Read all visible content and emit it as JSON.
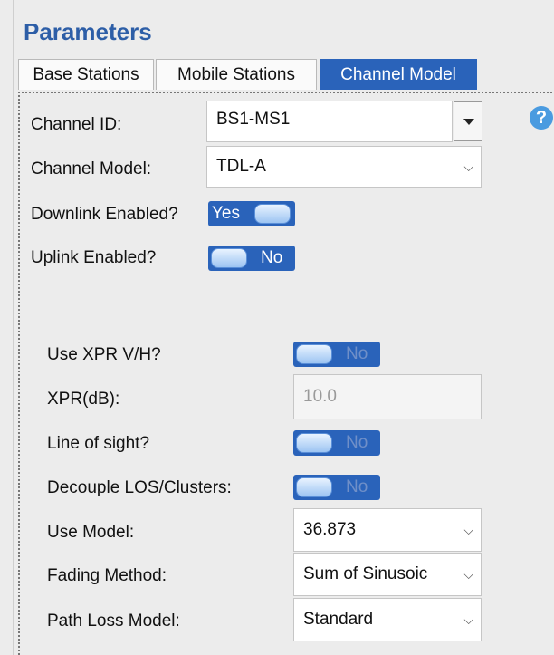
{
  "header": {
    "title": "Parameters"
  },
  "tabs": [
    {
      "label": "Base Stations"
    },
    {
      "label": "Mobile Stations"
    },
    {
      "label": "Channel Model"
    }
  ],
  "general": {
    "channel_id": {
      "label": "Channel ID:",
      "value": "BS1-MS1"
    },
    "channel_model": {
      "label": "Channel Model:",
      "value": "TDL-A"
    },
    "downlink": {
      "label": "Downlink Enabled?",
      "value": "Yes"
    },
    "uplink": {
      "label": "Uplink Enabled?",
      "value": "No"
    },
    "help_glyph": "?"
  },
  "advanced": {
    "use_xpr": {
      "label": "Use XPR V/H?",
      "value": "No"
    },
    "xpr_db": {
      "label": "XPR(dB):",
      "value": "10.0"
    },
    "line_of_sight": {
      "label": "Line of sight?",
      "value": "No"
    },
    "decouple": {
      "label": "Decouple LOS/Clusters:",
      "value": "No"
    },
    "use_model": {
      "label": "Use Model:",
      "value": "36.873"
    },
    "fading_method": {
      "label": "Fading Method:",
      "value": "Sum of Sinusoic"
    },
    "path_loss_model": {
      "label": "Path Loss Model:",
      "value": "Standard"
    }
  },
  "icons": {
    "chevron": "chevron-down-icon",
    "help": "help-icon"
  },
  "colors": {
    "title": "#2d5ea7",
    "active_tab": "#2a63ba",
    "toggle": "#2a63ba",
    "help": "#4a9be0"
  }
}
